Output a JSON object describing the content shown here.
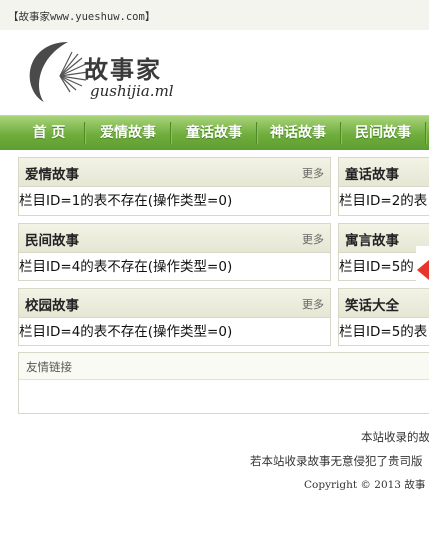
{
  "topbar": {
    "text": "【故事家www.yueshuw.com】"
  },
  "logo": {
    "cn": "故事家",
    "en": "gushijia.ml"
  },
  "nav": [
    {
      "label": "首 页"
    },
    {
      "label": "爱情故事"
    },
    {
      "label": "童话故事"
    },
    {
      "label": "神话故事"
    },
    {
      "label": "民间故事"
    }
  ],
  "panels": {
    "love": {
      "title": "爱情故事",
      "more": "更多",
      "body": "栏目ID=1的表不存在(操作类型=0)"
    },
    "fairy": {
      "title": "童话故事",
      "body": "栏目ID=2的表"
    },
    "folk": {
      "title": "民间故事",
      "more": "更多",
      "body": "栏目ID=4的表不存在(操作类型=0)"
    },
    "fable": {
      "title": "寓言故事",
      "body": "栏目ID=5的"
    },
    "campus": {
      "title": "校园故事",
      "more": "更多",
      "body": "栏目ID=4的表不存在(操作类型=0)"
    },
    "joke": {
      "title": "笑话大全",
      "body": "栏目ID=5的表"
    }
  },
  "links": {
    "title": "友情链接"
  },
  "footer": {
    "line1": "本站收录的故",
    "line2": "若本站收录故事无意侵犯了贵司版",
    "copyright": "Copyright © 2013 故事"
  },
  "colors": {
    "nav_green": "#6fae3c",
    "panel_head": "#e6e6d4",
    "border": "#d8d8c8",
    "arrow_red": "#e8342a"
  }
}
